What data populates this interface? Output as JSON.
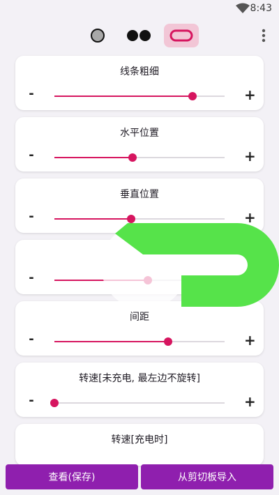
{
  "status": {
    "time": "8:43"
  },
  "toolbar": {
    "modes": [
      "single-dot",
      "double-dot",
      "pill"
    ],
    "active_mode": "pill",
    "accent": "#d6155f",
    "active_bg": "#f2c6d6"
  },
  "sliders": [
    {
      "label": "线条粗细",
      "value": 0.81
    },
    {
      "label": "水平位置",
      "value": 0.46
    },
    {
      "label": "垂直位置",
      "value": 0.45
    },
    {
      "label": "",
      "value": 0.55
    },
    {
      "label": "间距",
      "value": 0.67
    },
    {
      "label": "转速[未充电, 最左边不旋转]",
      "value": 0.0
    },
    {
      "label": "转速[充电时]",
      "value": null
    }
  ],
  "buttons": {
    "minus": "-",
    "plus": "+",
    "save": "查看(保存)",
    "import": "从剪切板导入"
  },
  "colors": {
    "accent": "#d6155f",
    "button": "#8f1fae",
    "overlay_green": "#56e34a"
  }
}
